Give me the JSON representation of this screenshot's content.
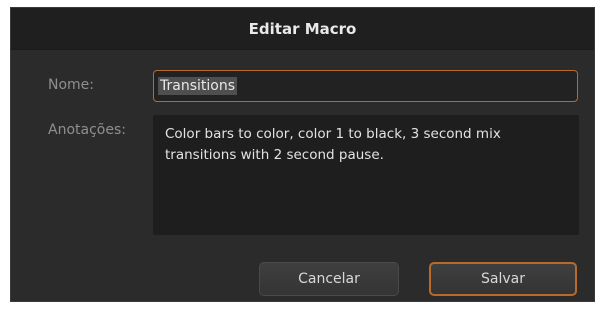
{
  "dialog": {
    "title": "Editar Macro",
    "name_label": "Nome:",
    "name_value": "Transitions",
    "notes_label": "Anotações:",
    "notes_value": "Color bars to color, color 1 to black, 3 second mix transitions with 2 second pause.",
    "cancel_label": "Cancelar",
    "save_label": "Salvar"
  },
  "colors": {
    "dialog_bg": "#2b2b2b",
    "titlebar_bg": "#1f1f1f",
    "focus_accent": "#b86a2a",
    "label_text": "#8f8f8f"
  }
}
